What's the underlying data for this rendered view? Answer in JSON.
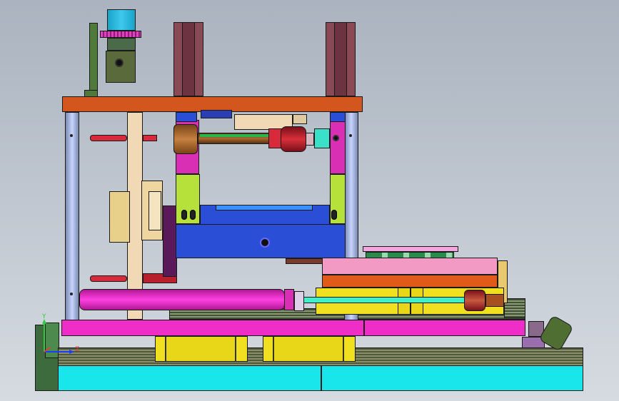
{
  "viewport": {
    "background_top": "#aab3bf",
    "background_bottom": "#d6dbe1"
  },
  "triad": {
    "y_label": "Y",
    "z_label": "Z",
    "y_color": "#2ecc40",
    "x_color": "#1a3cff",
    "z_color": "#e53935"
  },
  "palette": {
    "top_plate": "#d2561e",
    "purple_brown": "#8a4a55",
    "magenta": "#d82fb4",
    "lime": "#b6e03a",
    "navy_blue": "#2a4fd6",
    "pink_bar": "#ee2ec7",
    "cyan_base": "#19e6ea",
    "yellow": "#f0e020",
    "tan": "#f1d9b5",
    "olive": "#4f6e32"
  }
}
